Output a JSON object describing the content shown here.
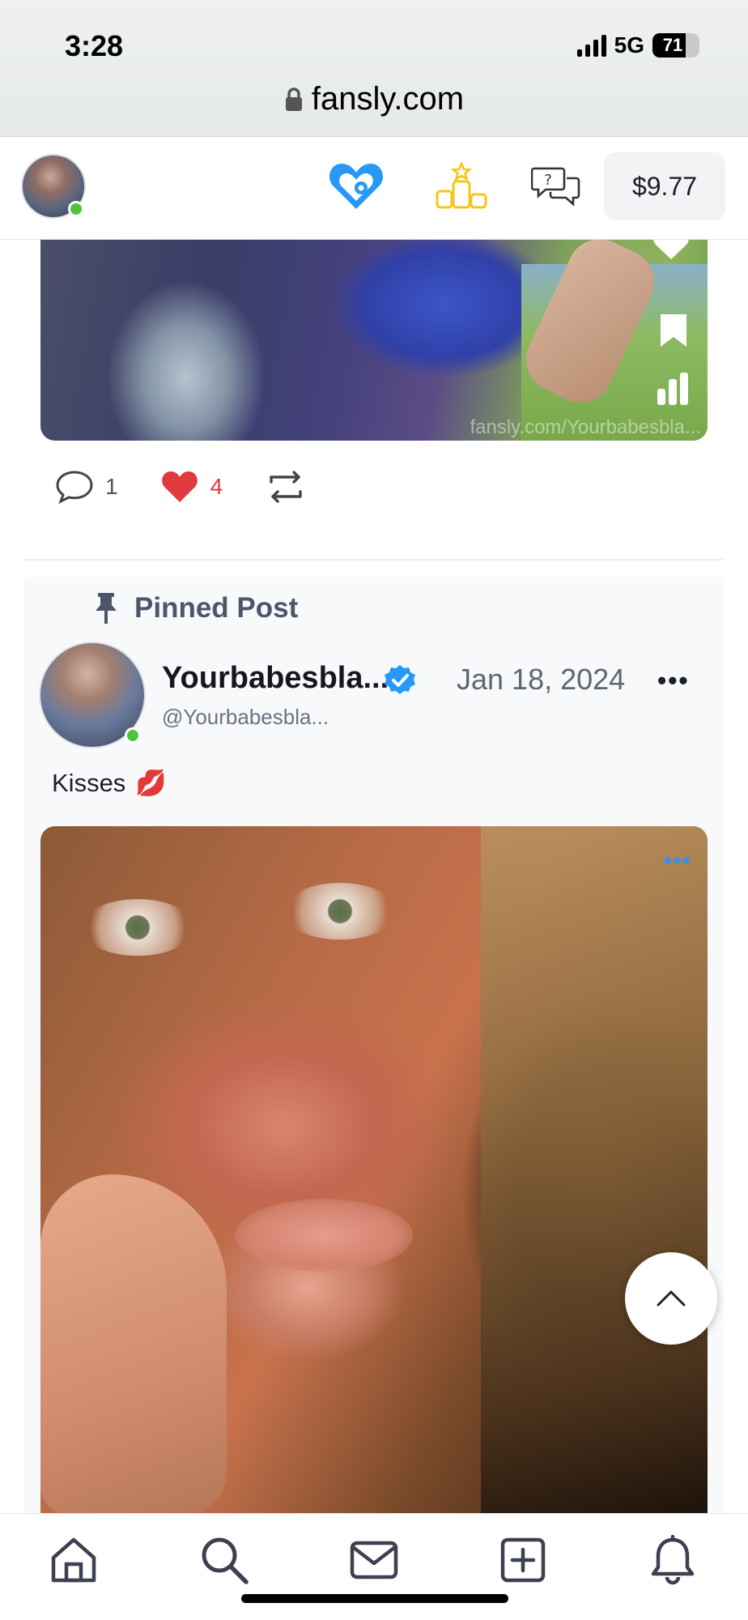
{
  "status_bar": {
    "time": "3:28",
    "network": "5G",
    "battery": "71",
    "battery_level_percent": 71
  },
  "browser": {
    "url": "fansly.com"
  },
  "header": {
    "icons": [
      "fansly-heart-logo-icon",
      "leaderboard-icon",
      "messages-help-icon"
    ],
    "balance": "$9.77",
    "accent_color": "#2699f7",
    "leaderboard_color": "#f5c518"
  },
  "previous_post": {
    "watermark": "fansly.com/Yourbabesbla...",
    "comments": "1",
    "likes": "4",
    "like_color": "#e0393e"
  },
  "pinned_post": {
    "pinned_label": "Pinned Post",
    "author_name": "Yourbabesbla...",
    "author_handle": "@Yourbabesbla...",
    "date": "Jan 18, 2024",
    "more": "•••",
    "text": "Kisses",
    "emoji": "💋",
    "media_more": "•••"
  },
  "bottom_nav": {
    "items": [
      "home-icon",
      "search-icon",
      "mail-icon",
      "add-post-icon",
      "notifications-icon"
    ]
  }
}
